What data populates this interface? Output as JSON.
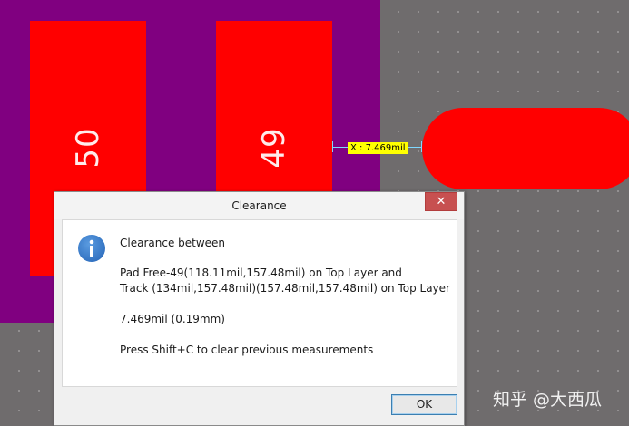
{
  "pcb": {
    "pads": [
      {
        "label": "50"
      },
      {
        "label": "49"
      }
    ],
    "measurement_label": "X : 7.469mil",
    "colors": {
      "background": "#6f6c6d",
      "copper_bottom": "#800080",
      "copper_top": "#ff0000",
      "measurement_badge": "#ffff00"
    }
  },
  "dialog": {
    "title": "Clearance",
    "close_label": "✕",
    "icon": "info-icon",
    "heading": "Clearance between",
    "line1": "Pad Free-49(118.11mil,157.48mil) on Top Layer and",
    "line2": "Track (134mil,157.48mil)(157.48mil,157.48mil) on Top Layer",
    "value": "7.469mil (0.19mm)",
    "hint": "Press Shift+C to clear previous measurements",
    "ok_label": "OK"
  },
  "watermark": "知乎 @大西瓜"
}
